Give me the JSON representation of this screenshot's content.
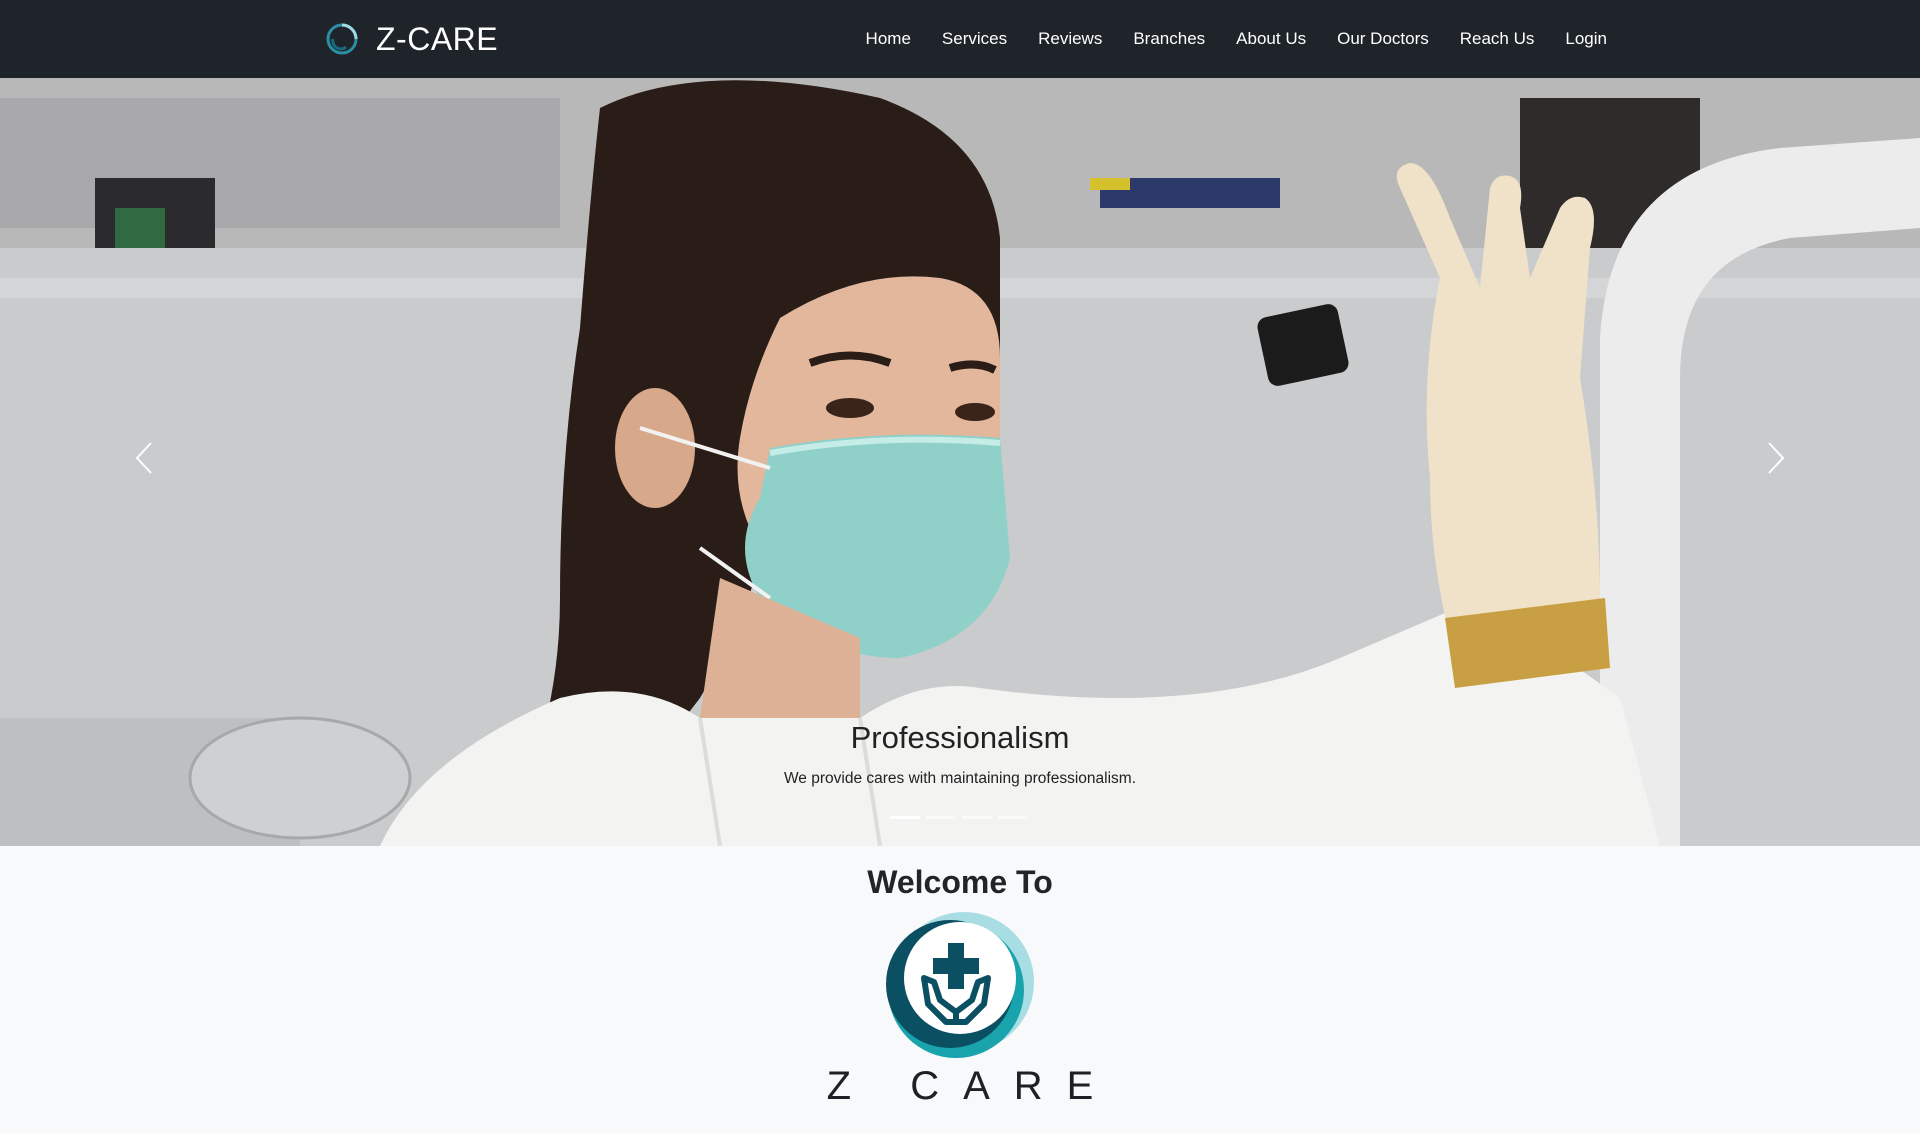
{
  "brand": {
    "name": "Z-CARE",
    "icon": "logo-ring-icon"
  },
  "nav": {
    "items": [
      {
        "label": "Home"
      },
      {
        "label": "Services"
      },
      {
        "label": "Reviews"
      },
      {
        "label": "Branches"
      },
      {
        "label": "About Us"
      },
      {
        "label": "Our Doctors"
      },
      {
        "label": "Reach Us"
      },
      {
        "label": "Login"
      }
    ]
  },
  "carousel": {
    "caption_title": "Professionalism",
    "caption_text": "We provide cares with maintaining professionalism.",
    "slide_count": 4,
    "active_slide": 1,
    "prev_icon": "chevron-left-icon",
    "next_icon": "chevron-right-icon"
  },
  "welcome": {
    "title": "Welcome To",
    "logo_icon": "medical-cross-hands-logo",
    "name": "Z CARE"
  },
  "colors": {
    "navbar_bg": "#1f232a",
    "logo_dark": "#0b4f63",
    "logo_teal": "#19a3ad",
    "logo_light": "#a8dde3",
    "page_bg": "#f8f9fa"
  }
}
